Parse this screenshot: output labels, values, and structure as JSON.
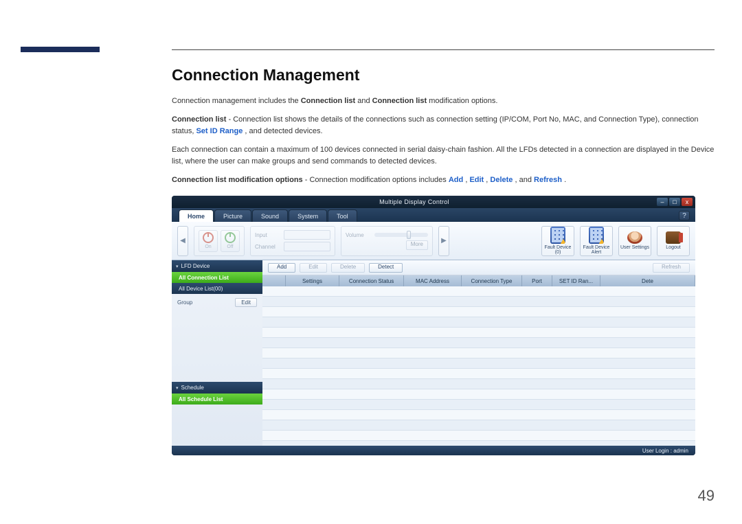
{
  "doc": {
    "heading": "Connection Management",
    "p1_prefix": "Connection management includes the ",
    "p1_b1": "Connection list",
    "p1_mid": " and ",
    "p1_b2": "Connection list",
    "p1_suffix": " modification options.",
    "p2_b": "Connection list",
    "p2_mid": " - Connection list shows the details of the connections such as connection setting (IP/COM, Port No, MAC, and Connection Type), connection status, ",
    "p2_blue": "Set ID Range",
    "p2_suffix": ", and detected devices.",
    "p3": "Each connection can contain a maximum of 100 devices connected in serial daisy-chain fashion. All the LFDs detected in a connection are displayed in the Device list, where the user can make groups and send commands to detected devices.",
    "p4_b": "Connection list modification options",
    "p4_mid": " - Connection modification options includes ",
    "p4_add": "Add",
    "p4_c1": ", ",
    "p4_edit": "Edit",
    "p4_c2": ", ",
    "p4_delete": "Delete",
    "p4_c3": ", and ",
    "p4_refresh": "Refresh",
    "p4_end": ".",
    "page_number": "49"
  },
  "app": {
    "title": "Multiple Display Control",
    "win": {
      "min": "–",
      "max": "□",
      "close": "x"
    },
    "tabs": [
      "Home",
      "Picture",
      "Sound",
      "System",
      "Tool"
    ],
    "help_icon": "?",
    "arrows": {
      "left": "◀",
      "right": "▶"
    },
    "power": {
      "on": "On",
      "off": "Off"
    },
    "fields": {
      "input": "Input",
      "channel": "Channel",
      "volume": "Volume",
      "more": "More"
    },
    "ribbon_buttons": {
      "fault_device": "Fault Device (0)",
      "fault_alert": "Fault Device Alert",
      "user_settings": "User Settings",
      "logout": "Logout"
    },
    "sidebar": {
      "lfd": "LFD Device",
      "all_conn": "All Connection List",
      "all_dev": "All Device List(00)",
      "group": "Group",
      "edit": "Edit",
      "schedule": "Schedule",
      "all_sched": "All Schedule List"
    },
    "toolbar": {
      "add": "Add",
      "edit": "Edit",
      "delete": "Delete",
      "detect": "Detect",
      "refresh": "Refresh"
    },
    "grid_headers": [
      "",
      "Settings",
      "Connection Status",
      "MAC Address",
      "Connection Type",
      "Port",
      "SET ID Ran...",
      "Dete"
    ],
    "status": "User Login : admin"
  }
}
